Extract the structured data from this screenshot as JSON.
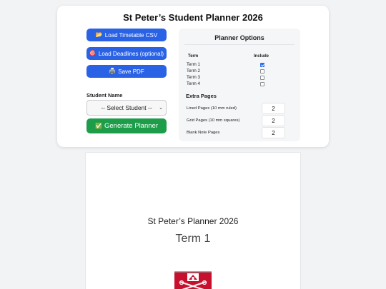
{
  "app": {
    "title": "St Peter’s Student Planner 2026"
  },
  "actions": {
    "load_timetable": {
      "icon": "📂",
      "label": "Load Timetable CSV"
    },
    "load_deadlines": {
      "icon": "🎯",
      "label": "Load Deadlines (optional)"
    },
    "save_pdf": {
      "icon": "🖨️",
      "label": "Save PDF"
    },
    "generate": {
      "icon": "✅",
      "label": "Generate Planner"
    }
  },
  "student": {
    "label": "Student Name",
    "selected": "-- Select Student --"
  },
  "options": {
    "title": "Planner Options",
    "col_term": "Term",
    "col_include": "Include",
    "terms": [
      {
        "label": "Term 1",
        "checked": true
      },
      {
        "label": "Term 2",
        "checked": false
      },
      {
        "label": "Term 3",
        "checked": false
      },
      {
        "label": "Term 4",
        "checked": false
      }
    ],
    "extra_title": "Extra Pages",
    "extra_pages": [
      {
        "label": "Lined Pages (10 mm ruled)",
        "value": "2"
      },
      {
        "label": "Grid Pages (10 mm squares)",
        "value": "2"
      },
      {
        "label": "Blank Note Pages",
        "value": "2"
      }
    ]
  },
  "preview": {
    "title": "St Peter’s Planner 2026",
    "term": "Term 1"
  },
  "colors": {
    "primary": "#2a62e6",
    "success": "#1d9d4a",
    "crest_red": "#c8102e"
  }
}
